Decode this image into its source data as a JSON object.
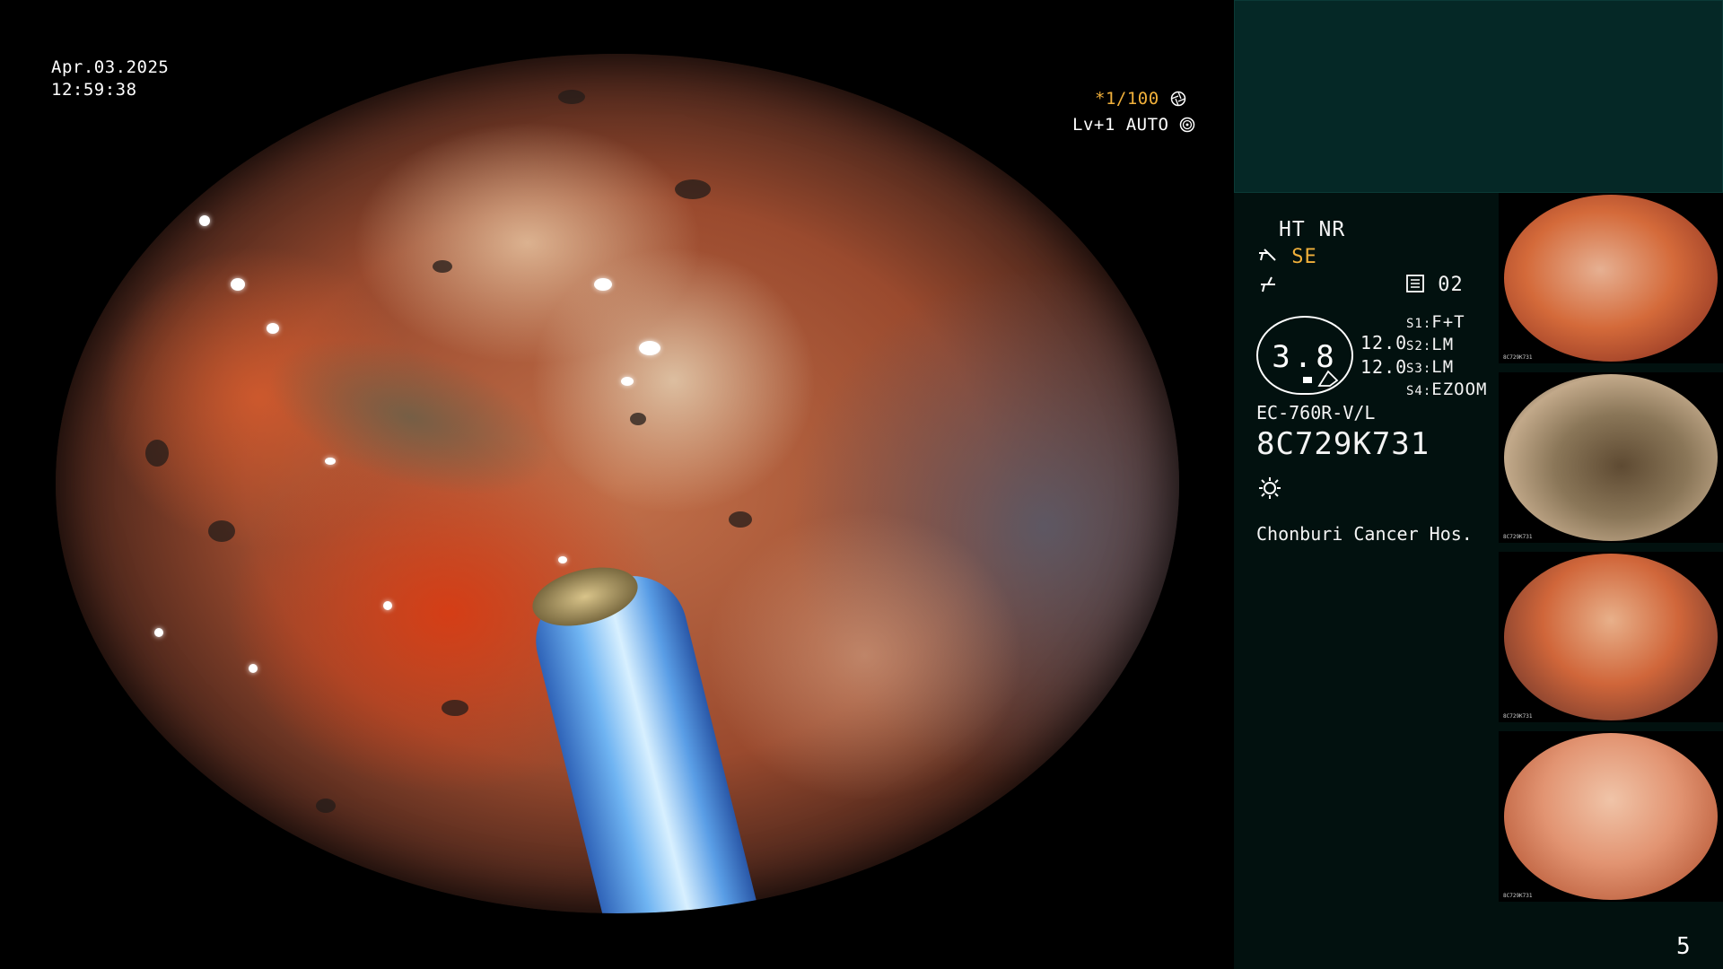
{
  "overlay": {
    "date": "Apr.03.2025",
    "time": "12:59:38",
    "shutter": "*1/100",
    "level": "Lv+1 AUTO"
  },
  "info_panel": {
    "mode_line": "HT NR",
    "enhancement": "SE",
    "memory_value": "02",
    "speed_value": "3.8",
    "value_1": "12.0",
    "value_2": "12.0",
    "switches": [
      {
        "key": "S1:",
        "value": "F+T"
      },
      {
        "key": "S2:",
        "value": "LM"
      },
      {
        "key": "S3:",
        "value": "LM"
      },
      {
        "key": "S4:",
        "value": "EZOOM"
      }
    ],
    "scope_model": "EC-760R-V/L",
    "serial_number": "8C729K731",
    "hospital": "Chonburi Cancer Hos."
  },
  "thumbnails": [
    {
      "serial": "8C729K731"
    },
    {
      "serial": "8C729K731"
    },
    {
      "serial": "8C729K731"
    },
    {
      "serial": "8C729K731"
    }
  ],
  "page_number": "5",
  "colors": {
    "accent_yellow": "#f2b13b",
    "panel_bg": "#02110f",
    "panel_top_bg": "#052826"
  },
  "icons": [
    "aperture-icon",
    "auto-iris-icon",
    "structure-enhance-icon",
    "freeze-icon",
    "memo-icon",
    "light-icon"
  ]
}
